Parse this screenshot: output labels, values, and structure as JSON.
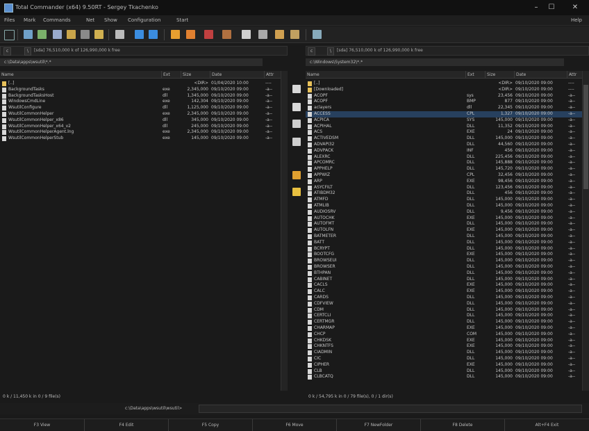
{
  "window": {
    "title": "Total Commander (x64) 9.50RT - Sergey Tkachenko"
  },
  "menu": [
    "Files",
    "Mark",
    "Commands",
    "Net",
    "Show",
    "Configuration",
    "Start"
  ],
  "help_label": "Help",
  "left_panel": {
    "drive": "c",
    "free_info": "[sda] 76,510,000 k of 126,990,000 k free",
    "path": "c:\\Data\\apps\\wsutil\\*.*",
    "columns": [
      "Name",
      "Ext",
      "Size",
      "Date",
      "Attr"
    ],
    "rows": [
      [
        "[..]",
        "",
        "<DIR>",
        "01/04/2020 10:00",
        "----"
      ],
      [
        "BackgroundTasks",
        "exe",
        "2,345,000",
        "09/10/2020 09:00",
        "-a--"
      ],
      [
        "BackgroundTasksHost",
        "dll",
        "1,345,000",
        "09/10/2020 09:00",
        "-a--"
      ],
      [
        "WindowsCmdLine",
        "exe",
        "142,304",
        "09/10/2020 09:00",
        "-a--"
      ],
      [
        "WsutilConfigure",
        "dll",
        "1,125,000",
        "09/10/2020 09:00",
        "-a--"
      ],
      [
        "WsutilCommonHelper",
        "exe",
        "2,345,000",
        "09/10/2020 09:00",
        "-a--"
      ],
      [
        "WsutilCommonHelper_x86",
        "dll",
        "345,000",
        "09/10/2020 09:00",
        "-a--"
      ],
      [
        "WsutilCommonHelper_x64_v2",
        "dll",
        "245,000",
        "09/10/2020 09:00",
        "-a--"
      ],
      [
        "WsutilCommonHelperAgent.lng",
        "exe",
        "2,345,000",
        "09/10/2020 09:00",
        "-a--"
      ],
      [
        "WsutilCommonHelperStub",
        "exe",
        "145,000",
        "09/10/2020 09:00",
        "-a--"
      ]
    ],
    "status": "0 k / 11,450 k in 0 / 9 file(s)"
  },
  "right_panel": {
    "drive": "c",
    "free_info": "[sda] 76,510,000 k of 126,990,000 k free",
    "path": "c:\\Windows\\System32\\*.*",
    "columns": [
      "Name",
      "Ext",
      "Size",
      "Date",
      "Attr"
    ],
    "rows": [
      [
        "[..]",
        "",
        "<DIR>",
        "09/10/2020 09:00",
        "----"
      ],
      [
        "[Downloaded]",
        "",
        "<DIR>",
        "09/10/2020 09:00",
        "----"
      ],
      [
        "ACOPF",
        "sys",
        "23,456",
        "09/10/2020 09:00",
        "-a--"
      ],
      [
        "ACOPF",
        "BMP",
        "877",
        "09/10/2020 09:00",
        "-a--"
      ],
      [
        "aclayers",
        "dll",
        "22,345",
        "09/10/2020 09:00",
        "-a--"
      ],
      [
        "ACCESS",
        "CPL",
        "1,327",
        "09/10/2020 09:00",
        "-a--"
      ],
      [
        "ACPICA",
        "SYS",
        "145,000",
        "09/10/2020 09:00",
        "-a--"
      ],
      [
        "ACPIHAL",
        "DLL",
        "11,352",
        "09/10/2020 09:00",
        "-a--"
      ],
      [
        "ACS",
        "EXE",
        "24",
        "09/10/2020 09:00",
        "-a--"
      ],
      [
        "ACTIVEDSM",
        "DLL",
        "145,000",
        "09/10/2020 09:00",
        "-a--"
      ],
      [
        "ADVAPI32",
        "DLL",
        "44,560",
        "09/10/2020 09:00",
        "-a--"
      ],
      [
        "ADVPACK",
        "INF",
        "456",
        "09/10/2020 09:00",
        "-a--"
      ],
      [
        "ALEXRC",
        "DLL",
        "225,456",
        "09/10/2020 09:00",
        "-a--"
      ],
      [
        "APCOMRC",
        "DLL",
        "145,888",
        "09/10/2020 09:00",
        "-a--"
      ],
      [
        "APPHELP",
        "DLL",
        "145,720",
        "09/10/2020 09:00",
        "-a--"
      ],
      [
        "APPWIZ",
        "CPL",
        "32,456",
        "09/10/2020 09:00",
        "-a--"
      ],
      [
        "ARP",
        "EXE",
        "98,456",
        "09/10/2020 09:00",
        "-a--"
      ],
      [
        "ASYCFILT",
        "DLL",
        "123,456",
        "09/10/2020 09:00",
        "-a--"
      ],
      [
        "ATIBDM32",
        "DLL",
        "456",
        "09/10/2020 09:00",
        "-a--"
      ],
      [
        "ATMFD",
        "DLL",
        "145,000",
        "09/10/2020 09:00",
        "-a--"
      ],
      [
        "ATMLIB",
        "DLL",
        "145,000",
        "09/10/2020 09:00",
        "-a--"
      ],
      [
        "AUDIOSRV",
        "DLL",
        "9,456",
        "09/10/2020 09:00",
        "-a--"
      ],
      [
        "AUTOCHK",
        "EXE",
        "145,000",
        "09/10/2020 09:00",
        "-a--"
      ],
      [
        "AUTOFMT",
        "DLL",
        "145,000",
        "09/10/2020 09:00",
        "-a--"
      ],
      [
        "AUTOLFN",
        "EXE",
        "145,000",
        "09/10/2020 09:00",
        "-a--"
      ],
      [
        "BATMETER",
        "DLL",
        "145,000",
        "09/10/2020 09:00",
        "-a--"
      ],
      [
        "BATT",
        "DLL",
        "145,000",
        "09/10/2020 09:00",
        "-a--"
      ],
      [
        "BCRYPT",
        "DLL",
        "145,000",
        "09/10/2020 09:00",
        "-a--"
      ],
      [
        "BOOTCFG",
        "EXE",
        "145,000",
        "09/10/2020 09:00",
        "-a--"
      ],
      [
        "BROWSEUI",
        "DLL",
        "145,000",
        "09/10/2020 09:00",
        "-a--"
      ],
      [
        "BROWSER",
        "DLL",
        "145,000",
        "09/10/2020 09:00",
        "-a--"
      ],
      [
        "BTHPAN",
        "DLL",
        "145,000",
        "09/10/2020 09:00",
        "-a--"
      ],
      [
        "CABINET",
        "DLL",
        "145,000",
        "09/10/2020 09:00",
        "-a--"
      ],
      [
        "CACLS",
        "EXE",
        "145,000",
        "09/10/2020 09:00",
        "-a--"
      ],
      [
        "CALC",
        "EXE",
        "145,000",
        "09/10/2020 09:00",
        "-a--"
      ],
      [
        "CARDS",
        "DLL",
        "145,000",
        "09/10/2020 09:00",
        "-a--"
      ],
      [
        "CDFVIEW",
        "DLL",
        "145,000",
        "09/10/2020 09:00",
        "-a--"
      ],
      [
        "CDM",
        "DLL",
        "145,000",
        "09/10/2020 09:00",
        "-a--"
      ],
      [
        "CERTCLI",
        "DLL",
        "145,000",
        "09/10/2020 09:00",
        "-a--"
      ],
      [
        "CERTMGR",
        "DLL",
        "145,000",
        "09/10/2020 09:00",
        "-a--"
      ],
      [
        "CHARMAP",
        "EXE",
        "145,000",
        "09/10/2020 09:00",
        "-a--"
      ],
      [
        "CHCP",
        "COM",
        "145,000",
        "09/10/2020 09:00",
        "-a--"
      ],
      [
        "CHKDSK",
        "EXE",
        "145,000",
        "09/10/2020 09:00",
        "-a--"
      ],
      [
        "CHKNTFS",
        "EXE",
        "145,000",
        "09/10/2020 09:00",
        "-a--"
      ],
      [
        "CIADMIN",
        "DLL",
        "145,000",
        "09/10/2020 09:00",
        "-a--"
      ],
      [
        "CIC",
        "DLL",
        "145,000",
        "09/10/2020 09:00",
        "-a--"
      ],
      [
        "CIPHER",
        "EXE",
        "145,000",
        "09/10/2020 09:00",
        "-a--"
      ],
      [
        "CLB",
        "DLL",
        "145,000",
        "09/10/2020 09:00",
        "-a--"
      ],
      [
        "CLBCATQ",
        "DLL",
        "145,000",
        "09/10/2020 09:00",
        "-a--"
      ]
    ],
    "status": "0 k / 54,795 k in 0 / 79 file(s), 0 / 1 dir(s)"
  },
  "command_prompt": "c:\\Data\\apps\\wsutil\\wsutil>",
  "fkeys": [
    "F3 View",
    "F4 Edit",
    "F5 Copy",
    "F6 Move",
    "F7 NewFolder",
    "F8 Delete",
    "Alt+F4 Exit"
  ],
  "colors": {
    "selection": "#27405e",
    "folder": "#e8c15a"
  }
}
